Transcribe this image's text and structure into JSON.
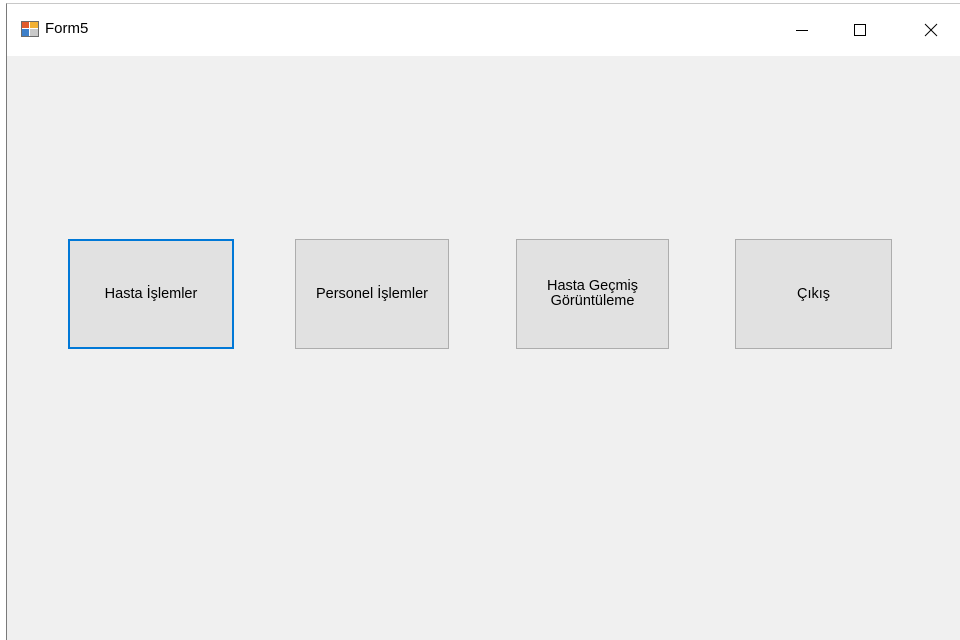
{
  "window": {
    "title": "Form5"
  },
  "caption_buttons": {
    "minimize": "minimize-icon",
    "maximize": "maximize-icon",
    "close": "close-icon"
  },
  "buttons": [
    {
      "label": "Hasta İşlemler",
      "focused": true
    },
    {
      "label": "Personel İşlemler",
      "focused": false
    },
    {
      "label": "Hasta Geçmiş\nGörüntüleme",
      "focused": false
    },
    {
      "label": "Çıkış",
      "focused": false
    }
  ],
  "colors": {
    "client_background": "#f0f0f0",
    "button_face": "#e1e1e1",
    "button_border": "#adadad",
    "focus_border": "#0078d7"
  }
}
